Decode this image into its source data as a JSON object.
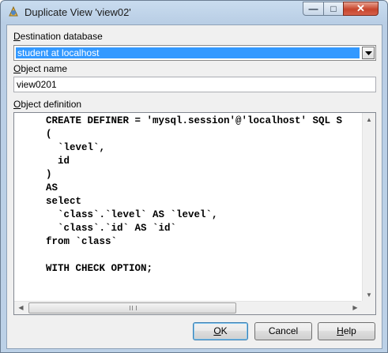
{
  "window": {
    "title": "Duplicate View 'view02'"
  },
  "caption_buttons": {
    "minimize": "—",
    "maximize": "□",
    "close": "✕"
  },
  "form": {
    "destination_label_first": "D",
    "destination_label_rest": "estination database",
    "destination_value": "student at localhost",
    "object_name_label_first": "O",
    "object_name_label_rest": "bject name",
    "object_name_value": "view0201",
    "definition_label_first": "O",
    "definition_label_rest": "bject definition"
  },
  "code_lines": [
    "CREATE DEFINER = 'mysql.session'@'localhost' SQL S",
    "(",
    "  `level`,",
    "  id",
    ")",
    "AS",
    "select",
    "  `class`.`level` AS `level`,",
    "  `class`.`id` AS `id`",
    "from `class`",
    "",
    "WITH CHECK OPTION;"
  ],
  "buttons": {
    "ok_first": "O",
    "ok_rest": "K",
    "cancel": "Cancel",
    "help_first": "H",
    "help_rest": "elp"
  },
  "icons": {
    "app": "app-icon",
    "dropdown": "chevron-down-icon"
  }
}
